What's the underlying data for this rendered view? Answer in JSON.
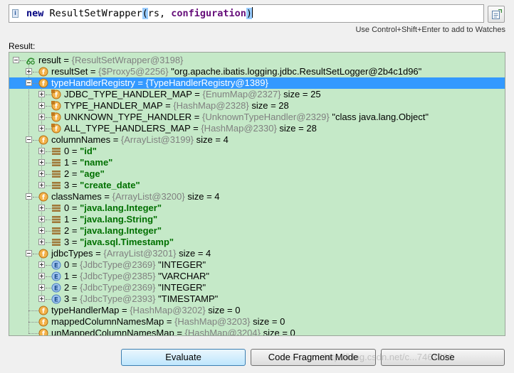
{
  "expression": {
    "keyword": "new",
    "class_name": "ResultSetWrapper",
    "arg1": "rs",
    "separator": ", ",
    "arg2": "configuration"
  },
  "hint": "Use Control+Shift+Enter to add to Watches",
  "result_label": "Result:",
  "tree": [
    {
      "level": 0,
      "exp": "expanded",
      "icon": "watch-result-icon",
      "name": "result",
      "type": "{ResultSetWrapper@3198}",
      "value": "",
      "str": false
    },
    {
      "level": 1,
      "exp": "collapsed",
      "icon": "field-icon",
      "name": "resultSet",
      "type": "{$Proxy5@2256}",
      "value": "\"org.apache.ibatis.logging.jdbc.ResultSetLogger@2b4c1d96\"",
      "str": false
    },
    {
      "level": 1,
      "exp": "expanded",
      "icon": "field-icon",
      "name": "typeHandlerRegistry",
      "type": "{TypeHandlerRegistry@1389}",
      "value": "",
      "str": false,
      "selected": true
    },
    {
      "level": 2,
      "exp": "collapsed",
      "icon": "final-field-icon",
      "name": "JDBC_TYPE_HANDLER_MAP",
      "type": "{EnumMap@2327}",
      "value": "size = 25",
      "str": false
    },
    {
      "level": 2,
      "exp": "collapsed",
      "icon": "final-field-icon",
      "name": "TYPE_HANDLER_MAP",
      "type": "{HashMap@2328}",
      "value": "size = 28",
      "str": false
    },
    {
      "level": 2,
      "exp": "collapsed",
      "icon": "final-field-icon",
      "name": "UNKNOWN_TYPE_HANDLER",
      "type": "{UnknownTypeHandler@2329}",
      "value": "\"class java.lang.Object\"",
      "str": false
    },
    {
      "level": 2,
      "exp": "collapsed",
      "icon": "final-field-icon",
      "name": "ALL_TYPE_HANDLERS_MAP",
      "type": "{HashMap@2330}",
      "value": "size = 28",
      "str": false
    },
    {
      "level": 1,
      "exp": "expanded",
      "icon": "field-icon",
      "name": "columnNames",
      "type": "{ArrayList@3199}",
      "value": "size = 4",
      "str": false
    },
    {
      "level": 2,
      "exp": "collapsed",
      "icon": "array-element-icon",
      "name": "0",
      "type": "",
      "value": "\"id\"",
      "str": true
    },
    {
      "level": 2,
      "exp": "collapsed",
      "icon": "array-element-icon",
      "name": "1",
      "type": "",
      "value": "\"name\"",
      "str": true
    },
    {
      "level": 2,
      "exp": "collapsed",
      "icon": "array-element-icon",
      "name": "2",
      "type": "",
      "value": "\"age\"",
      "str": true
    },
    {
      "level": 2,
      "exp": "collapsed",
      "icon": "array-element-icon",
      "name": "3",
      "type": "",
      "value": "\"create_date\"",
      "str": true
    },
    {
      "level": 1,
      "exp": "expanded",
      "icon": "field-icon",
      "name": "classNames",
      "type": "{ArrayList@3200}",
      "value": "size = 4",
      "str": false
    },
    {
      "level": 2,
      "exp": "collapsed",
      "icon": "array-element-icon",
      "name": "0",
      "type": "",
      "value": "\"java.lang.Integer\"",
      "str": true
    },
    {
      "level": 2,
      "exp": "collapsed",
      "icon": "array-element-icon",
      "name": "1",
      "type": "",
      "value": "\"java.lang.String\"",
      "str": true
    },
    {
      "level": 2,
      "exp": "collapsed",
      "icon": "array-element-icon",
      "name": "2",
      "type": "",
      "value": "\"java.lang.Integer\"",
      "str": true
    },
    {
      "level": 2,
      "exp": "collapsed",
      "icon": "array-element-icon",
      "name": "3",
      "type": "",
      "value": "\"java.sql.Timestamp\"",
      "str": true
    },
    {
      "level": 1,
      "exp": "expanded",
      "icon": "field-icon",
      "name": "jdbcTypes",
      "type": "{ArrayList@3201}",
      "value": "size = 4",
      "str": false
    },
    {
      "level": 2,
      "exp": "collapsed",
      "icon": "enum-icon",
      "name": "0",
      "type": "{JdbcType@2369}",
      "value": "\"INTEGER\"",
      "str": false
    },
    {
      "level": 2,
      "exp": "collapsed",
      "icon": "enum-icon",
      "name": "1",
      "type": "{JdbcType@2385}",
      "value": "\"VARCHAR\"",
      "str": false
    },
    {
      "level": 2,
      "exp": "collapsed",
      "icon": "enum-icon",
      "name": "2",
      "type": "{JdbcType@2369}",
      "value": "\"INTEGER\"",
      "str": false
    },
    {
      "level": 2,
      "exp": "collapsed",
      "icon": "enum-icon",
      "name": "3",
      "type": "{JdbcType@2393}",
      "value": "\"TIMESTAMP\"",
      "str": false
    },
    {
      "level": 1,
      "exp": "none",
      "icon": "field-icon",
      "name": "typeHandlerMap",
      "type": "{HashMap@3202}",
      "value": "size = 0",
      "str": false
    },
    {
      "level": 1,
      "exp": "none",
      "icon": "field-icon",
      "name": "mappedColumnNamesMap",
      "type": "{HashMap@3203}",
      "value": "size = 0",
      "str": false
    },
    {
      "level": 1,
      "exp": "none",
      "icon": "field-icon",
      "name": "unMappedColumnNamesMap",
      "type": "{HashMap@3204}",
      "value": "size = 0",
      "str": false
    }
  ],
  "buttons": {
    "evaluate": "Evaluate",
    "code_fragment": "Code Fragment Mode",
    "close": "Close"
  },
  "watermark": "http://blog.csdn.net/c...7461296"
}
